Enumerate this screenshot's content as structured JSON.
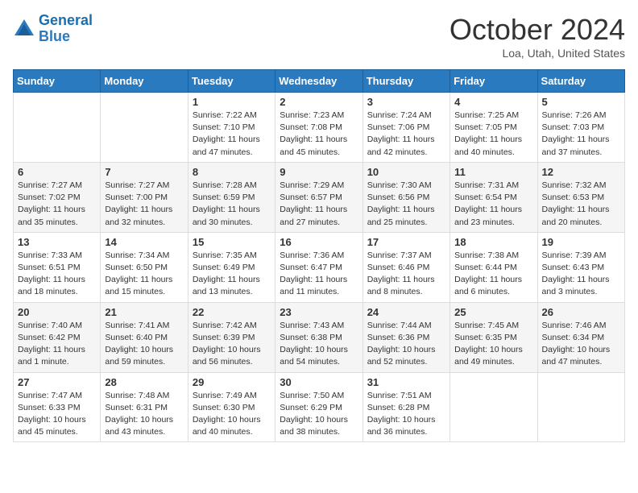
{
  "header": {
    "logo_line1": "General",
    "logo_line2": "Blue",
    "month": "October 2024",
    "location": "Loa, Utah, United States"
  },
  "days_of_week": [
    "Sunday",
    "Monday",
    "Tuesday",
    "Wednesday",
    "Thursday",
    "Friday",
    "Saturday"
  ],
  "weeks": [
    [
      {
        "day": "",
        "info": ""
      },
      {
        "day": "",
        "info": ""
      },
      {
        "day": "1",
        "info": "Sunrise: 7:22 AM\nSunset: 7:10 PM\nDaylight: 11 hours and 47 minutes."
      },
      {
        "day": "2",
        "info": "Sunrise: 7:23 AM\nSunset: 7:08 PM\nDaylight: 11 hours and 45 minutes."
      },
      {
        "day": "3",
        "info": "Sunrise: 7:24 AM\nSunset: 7:06 PM\nDaylight: 11 hours and 42 minutes."
      },
      {
        "day": "4",
        "info": "Sunrise: 7:25 AM\nSunset: 7:05 PM\nDaylight: 11 hours and 40 minutes."
      },
      {
        "day": "5",
        "info": "Sunrise: 7:26 AM\nSunset: 7:03 PM\nDaylight: 11 hours and 37 minutes."
      }
    ],
    [
      {
        "day": "6",
        "info": "Sunrise: 7:27 AM\nSunset: 7:02 PM\nDaylight: 11 hours and 35 minutes."
      },
      {
        "day": "7",
        "info": "Sunrise: 7:27 AM\nSunset: 7:00 PM\nDaylight: 11 hours and 32 minutes."
      },
      {
        "day": "8",
        "info": "Sunrise: 7:28 AM\nSunset: 6:59 PM\nDaylight: 11 hours and 30 minutes."
      },
      {
        "day": "9",
        "info": "Sunrise: 7:29 AM\nSunset: 6:57 PM\nDaylight: 11 hours and 27 minutes."
      },
      {
        "day": "10",
        "info": "Sunrise: 7:30 AM\nSunset: 6:56 PM\nDaylight: 11 hours and 25 minutes."
      },
      {
        "day": "11",
        "info": "Sunrise: 7:31 AM\nSunset: 6:54 PM\nDaylight: 11 hours and 23 minutes."
      },
      {
        "day": "12",
        "info": "Sunrise: 7:32 AM\nSunset: 6:53 PM\nDaylight: 11 hours and 20 minutes."
      }
    ],
    [
      {
        "day": "13",
        "info": "Sunrise: 7:33 AM\nSunset: 6:51 PM\nDaylight: 11 hours and 18 minutes."
      },
      {
        "day": "14",
        "info": "Sunrise: 7:34 AM\nSunset: 6:50 PM\nDaylight: 11 hours and 15 minutes."
      },
      {
        "day": "15",
        "info": "Sunrise: 7:35 AM\nSunset: 6:49 PM\nDaylight: 11 hours and 13 minutes."
      },
      {
        "day": "16",
        "info": "Sunrise: 7:36 AM\nSunset: 6:47 PM\nDaylight: 11 hours and 11 minutes."
      },
      {
        "day": "17",
        "info": "Sunrise: 7:37 AM\nSunset: 6:46 PM\nDaylight: 11 hours and 8 minutes."
      },
      {
        "day": "18",
        "info": "Sunrise: 7:38 AM\nSunset: 6:44 PM\nDaylight: 11 hours and 6 minutes."
      },
      {
        "day": "19",
        "info": "Sunrise: 7:39 AM\nSunset: 6:43 PM\nDaylight: 11 hours and 3 minutes."
      }
    ],
    [
      {
        "day": "20",
        "info": "Sunrise: 7:40 AM\nSunset: 6:42 PM\nDaylight: 11 hours and 1 minute."
      },
      {
        "day": "21",
        "info": "Sunrise: 7:41 AM\nSunset: 6:40 PM\nDaylight: 10 hours and 59 minutes."
      },
      {
        "day": "22",
        "info": "Sunrise: 7:42 AM\nSunset: 6:39 PM\nDaylight: 10 hours and 56 minutes."
      },
      {
        "day": "23",
        "info": "Sunrise: 7:43 AM\nSunset: 6:38 PM\nDaylight: 10 hours and 54 minutes."
      },
      {
        "day": "24",
        "info": "Sunrise: 7:44 AM\nSunset: 6:36 PM\nDaylight: 10 hours and 52 minutes."
      },
      {
        "day": "25",
        "info": "Sunrise: 7:45 AM\nSunset: 6:35 PM\nDaylight: 10 hours and 49 minutes."
      },
      {
        "day": "26",
        "info": "Sunrise: 7:46 AM\nSunset: 6:34 PM\nDaylight: 10 hours and 47 minutes."
      }
    ],
    [
      {
        "day": "27",
        "info": "Sunrise: 7:47 AM\nSunset: 6:33 PM\nDaylight: 10 hours and 45 minutes."
      },
      {
        "day": "28",
        "info": "Sunrise: 7:48 AM\nSunset: 6:31 PM\nDaylight: 10 hours and 43 minutes."
      },
      {
        "day": "29",
        "info": "Sunrise: 7:49 AM\nSunset: 6:30 PM\nDaylight: 10 hours and 40 minutes."
      },
      {
        "day": "30",
        "info": "Sunrise: 7:50 AM\nSunset: 6:29 PM\nDaylight: 10 hours and 38 minutes."
      },
      {
        "day": "31",
        "info": "Sunrise: 7:51 AM\nSunset: 6:28 PM\nDaylight: 10 hours and 36 minutes."
      },
      {
        "day": "",
        "info": ""
      },
      {
        "day": "",
        "info": ""
      }
    ]
  ]
}
